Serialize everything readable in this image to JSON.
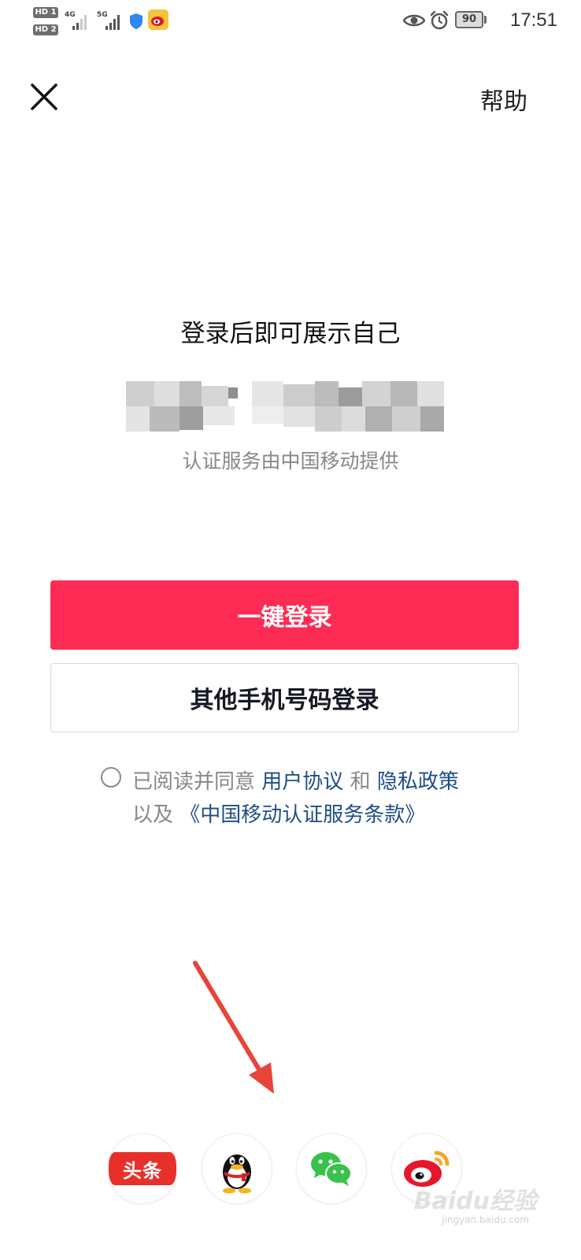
{
  "status_bar": {
    "hd1": "HD 1",
    "hd2": "HD 2",
    "net1": "4G",
    "net2": "5G",
    "battery": "90",
    "time": "17:51",
    "icons": [
      "shield-icon",
      "weibo-icon",
      "eye-icon",
      "alarm-icon",
      "battery-icon"
    ]
  },
  "header": {
    "close_icon": "close-icon",
    "help": "帮助"
  },
  "main": {
    "headline": "登录后即可展示自己",
    "provider": "认证服务由中国移动提供"
  },
  "buttons": {
    "one_click": "一键登录",
    "other_phone": "其他手机号码登录"
  },
  "agreement": {
    "prefix": "已阅读并同意",
    "user_agreement": "用户协议",
    "and": "和",
    "privacy": "隐私政策",
    "also": "以及",
    "cmcc_terms": "《中国移动认证服务条款》"
  },
  "social": {
    "toutiao": "头条",
    "icons": [
      "toutiao-icon",
      "qq-icon",
      "wechat-icon",
      "weibo-icon"
    ]
  },
  "watermark": {
    "text": "Baidu经验",
    "sub": "jingyan.baidu.com"
  },
  "colors": {
    "primary": "#fe2c55",
    "link": "#1f4e86",
    "muted": "#888888"
  }
}
